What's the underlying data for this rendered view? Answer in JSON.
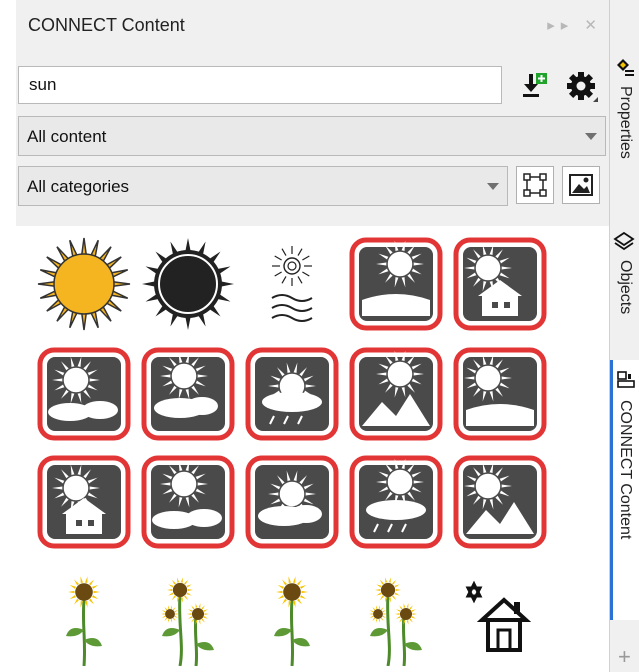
{
  "panel": {
    "title": "CONNECT Content",
    "title_buttons": {
      "expand": "▸▸",
      "close": "✕"
    }
  },
  "search": {
    "value": "sun",
    "placeholder": ""
  },
  "toolbar": {
    "import_icon": "import-download-icon",
    "settings_icon": "gear-icon"
  },
  "filters": {
    "content": {
      "selected": "All content"
    },
    "categories": {
      "selected": "All categories"
    }
  },
  "results": [
    {
      "name": "sun-yellow",
      "kind": "sun-yellow"
    },
    {
      "name": "sun-black",
      "kind": "sun-black"
    },
    {
      "name": "sun-over-waves",
      "kind": "sun-waves"
    },
    {
      "name": "sun-behind-clouds-1",
      "kind": "weather"
    },
    {
      "name": "sun-behind-clouds-2",
      "kind": "weather"
    },
    {
      "name": "sun-clouds-rain",
      "kind": "weather"
    },
    {
      "name": "sun-over-hills",
      "kind": "weather"
    },
    {
      "name": "sun-mountains-1",
      "kind": "weather"
    },
    {
      "name": "sun-mountains-2",
      "kind": "weather"
    },
    {
      "name": "sun-ship-clouds",
      "kind": "weather"
    },
    {
      "name": "sunset-horizon",
      "kind": "weather"
    },
    {
      "name": "sun-house",
      "kind": "weather"
    },
    {
      "name": "sun-bright",
      "kind": "weather"
    },
    {
      "name": "sun-cloud-bank",
      "kind": "weather"
    },
    {
      "name": "sun-partly-cloudy",
      "kind": "weather"
    },
    {
      "name": "sunflower-group-1",
      "kind": "sunflower"
    },
    {
      "name": "sunflower-single-1",
      "kind": "sunflower"
    },
    {
      "name": "sunflower-group-2",
      "kind": "sunflower"
    },
    {
      "name": "sunflower-single-2",
      "kind": "sunflower"
    },
    {
      "name": "star-house",
      "kind": "house"
    }
  ],
  "side_tabs": [
    {
      "label": "Properties",
      "icon": "properties-icon",
      "active": false
    },
    {
      "label": "Objects",
      "icon": "layers-icon",
      "active": false
    },
    {
      "label": "CONNECT Content",
      "icon": "connect-icon",
      "active": true
    }
  ],
  "side_add": "+",
  "colors": {
    "accent": "#2b72d6",
    "frame_red": "#e23535",
    "tile_dark": "#4a4a4a",
    "sun_yellow": "#f5b521"
  }
}
